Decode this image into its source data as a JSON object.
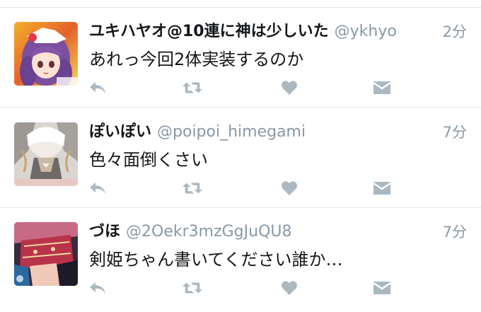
{
  "colors": {
    "text": "#14171a",
    "muted": "#8899a6",
    "icon": "#aab8c2",
    "divider": "#e1e8ed"
  },
  "tweets": [
    {
      "display_name": "ユキハヤオ@10連に神は少しいた",
      "handle": "@ykhyo",
      "time": "2分",
      "text": "あれっ今回2体実装するのか",
      "avatar": "anime-girl-purple-hair-avatar"
    },
    {
      "display_name": "ぽいぽい",
      "handle": "@poipoi_himegami",
      "time": "7分",
      "text": "色々面倒くさい",
      "avatar": "anime-character-white-armor-avatar"
    },
    {
      "display_name": "づほ",
      "handle": "@2Oekr3mzGgJuQU8",
      "time": "7分",
      "text": "剣姫ちゃん書いてください誰か…",
      "avatar": "anime-character-red-dress-avatar"
    }
  ],
  "actions": [
    "reply-icon",
    "retweet-icon",
    "like-icon",
    "direct-message-icon"
  ]
}
